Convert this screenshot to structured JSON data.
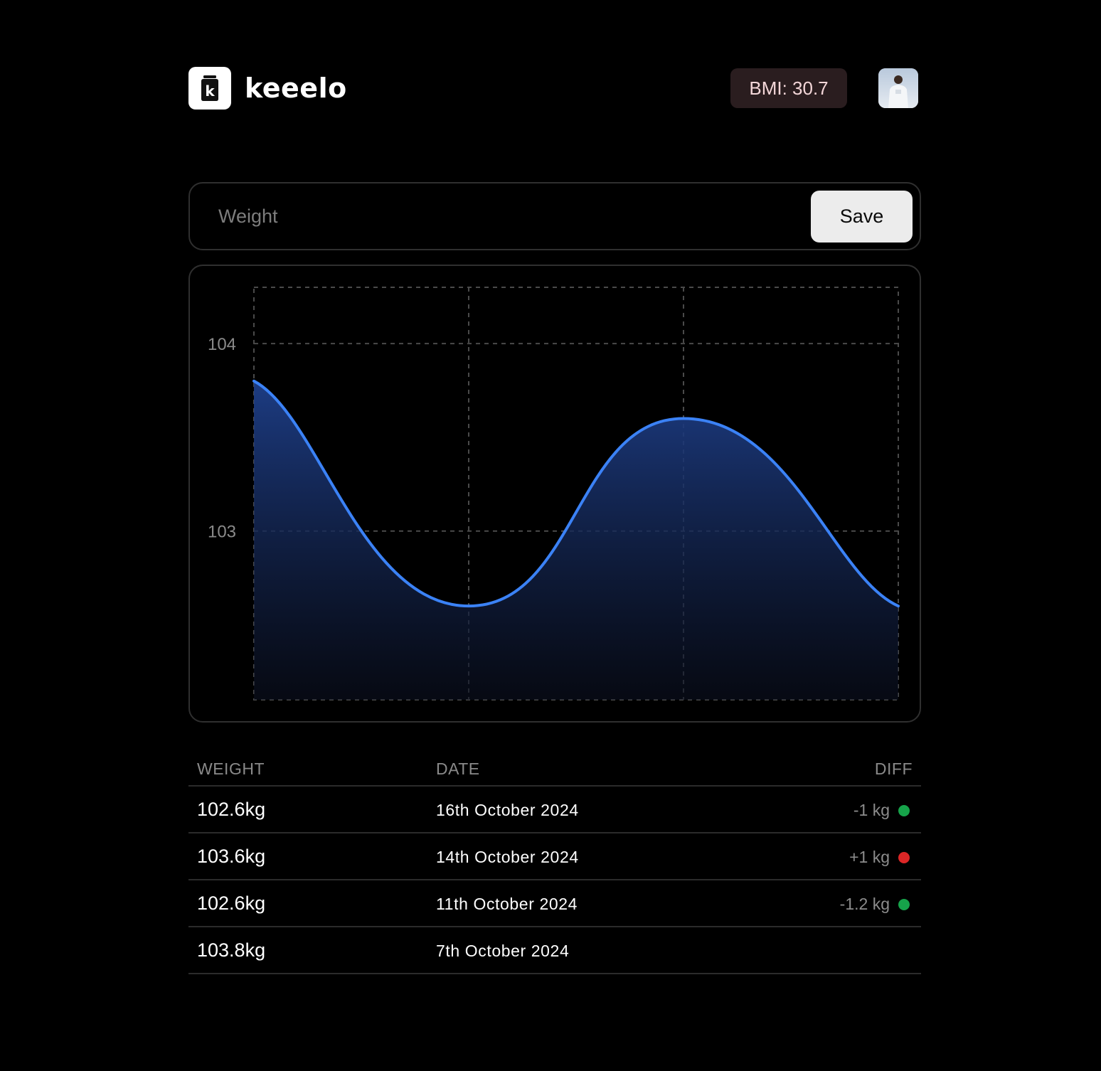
{
  "app": {
    "name": "keeelo",
    "logo_letter": "k"
  },
  "header": {
    "bmi_label": "BMI: 30.7",
    "avatar_icon": "user-avatar-photo"
  },
  "entry": {
    "placeholder": "Weight",
    "value": "",
    "save_label": "Save"
  },
  "chart_data": {
    "type": "area",
    "x": [
      "7th October 2024",
      "11th October 2024",
      "14th October 2024",
      "16th October 2024"
    ],
    "series": [
      {
        "values": [
          103.8,
          102.6,
          103.6,
          102.6
        ]
      }
    ],
    "y_ticks": [
      103,
      104
    ],
    "ylim": [
      102.1,
      104.3
    ],
    "grid": true,
    "line_color": "#3b82f6",
    "fill_color": "#1e3a8a"
  },
  "table": {
    "columns": {
      "weight": "WEIGHT",
      "date": "DATE",
      "diff": "DIFF"
    },
    "rows": [
      {
        "weight": "102.6kg",
        "date": "16th October 2024",
        "diff": "-1 kg",
        "status": "down"
      },
      {
        "weight": "103.6kg",
        "date": "14th October 2024",
        "diff": "+1 kg",
        "status": "up"
      },
      {
        "weight": "102.6kg",
        "date": "11th October 2024",
        "diff": "-1.2 kg",
        "status": "down"
      },
      {
        "weight": "103.8kg",
        "date": "7th October 2024",
        "diff": "",
        "status": "none"
      }
    ]
  },
  "colors": {
    "down": "#16a34a",
    "up": "#dc2626",
    "accent": "#3b82f6"
  }
}
